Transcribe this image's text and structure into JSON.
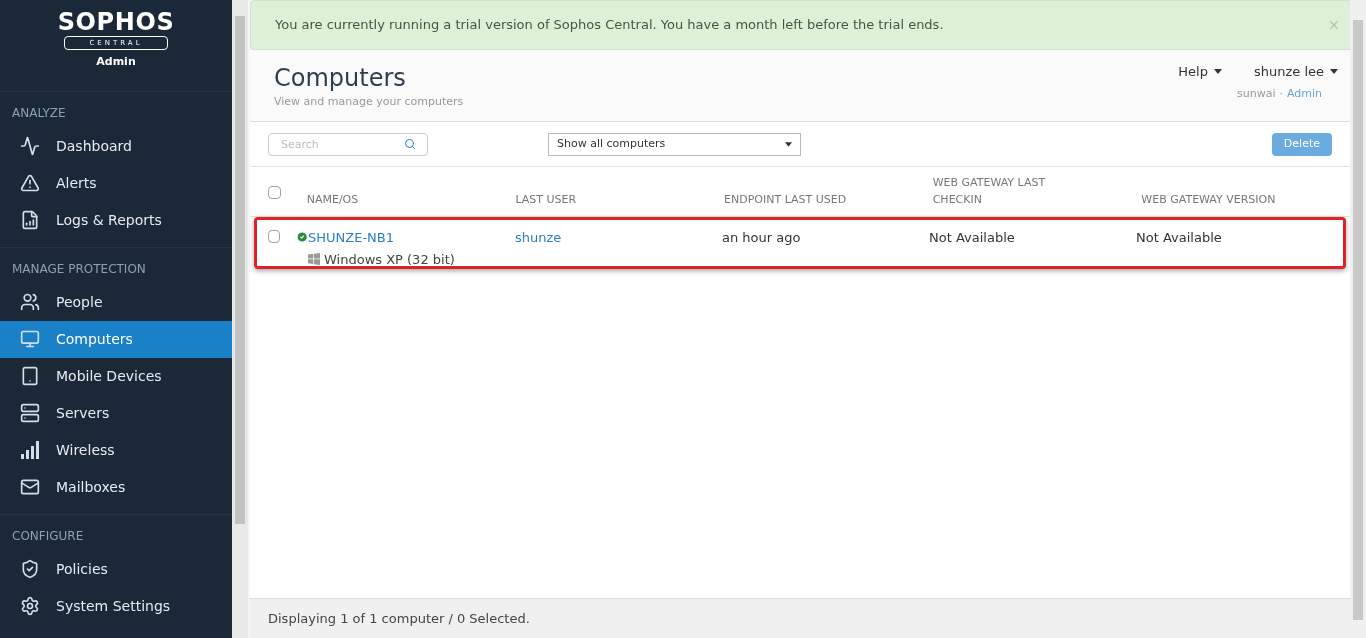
{
  "sidebar": {
    "logo": "SOPHOS",
    "logo_sub": "CENTRAL",
    "role": "Admin",
    "sections": [
      {
        "title": "ANALYZE",
        "items": [
          {
            "label": "Dashboard",
            "selected": false
          },
          {
            "label": "Alerts",
            "selected": false
          },
          {
            "label": "Logs & Reports",
            "selected": false
          }
        ]
      },
      {
        "title": "MANAGE PROTECTION",
        "items": [
          {
            "label": "People",
            "selected": false
          },
          {
            "label": "Computers",
            "selected": true
          },
          {
            "label": "Mobile Devices",
            "selected": false
          },
          {
            "label": "Servers",
            "selected": false
          },
          {
            "label": "Wireless",
            "selected": false
          },
          {
            "label": "Mailboxes",
            "selected": false
          }
        ]
      },
      {
        "title": "CONFIGURE",
        "items": [
          {
            "label": "Policies",
            "selected": false
          },
          {
            "label": "System Settings",
            "selected": false
          }
        ]
      }
    ]
  },
  "banner": {
    "text": "You are currently running a trial version of Sophos Central. You have a month left before the trial ends."
  },
  "header": {
    "title": "Computers",
    "subtitle": "View and manage your computers",
    "help": "Help",
    "user": "shunze lee",
    "account": "sunwai",
    "separator": "·",
    "role": "Admin"
  },
  "toolbar": {
    "search": {
      "placeholder": "Search"
    },
    "filter": "Show all computers",
    "delete": "Delete"
  },
  "table": {
    "select_all": false,
    "columns": [
      "NAME/OS",
      "LAST USER",
      "ENDPOINT LAST USED",
      "WEB GATEWAY LAST CHECKIN",
      "WEB GATEWAY VERSION"
    ],
    "rows": [
      {
        "checked": false,
        "highlighted": true,
        "healthy": true,
        "name": "SHUNZE-NB1",
        "os": "Windows XP (32 bit)",
        "last_user": "shunze",
        "endpoint_last_used": "an hour ago",
        "web_gateway_last_checkin": "Not Available",
        "web_gateway_version": "Not Available"
      }
    ]
  },
  "status_bar": "Displaying 1 of 1 computer / 0 Selected."
}
